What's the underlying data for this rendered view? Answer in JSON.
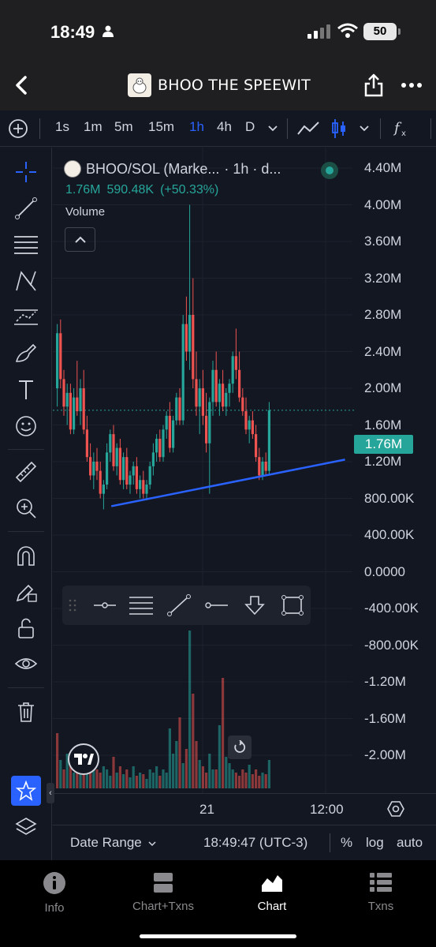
{
  "status_bar": {
    "time": "18:49",
    "battery": "50"
  },
  "header": {
    "title": "BHOO THE SPEEWIT"
  },
  "toolbar": {
    "intervals": [
      "1s",
      "1m",
      "5m",
      "15m",
      "1h",
      "4h",
      "D"
    ],
    "active_interval": "1h"
  },
  "legend": {
    "symbol": "BHOO/SOL (Marke...",
    "interval_text": "· 1h · d...",
    "price": "1.76M",
    "change_abs": "590.48K",
    "change_pct": "(+50.33%)",
    "volume_label": "Volume"
  },
  "price_axis": [
    "4.40M",
    "4.00M",
    "3.60M",
    "3.20M",
    "2.80M",
    "2.40M",
    "2.00M",
    "1.60M",
    "1.20M",
    "800.00K",
    "400.00K",
    "0.0000",
    "-400.00K",
    "-800.00K",
    "-1.20M",
    "-1.60M",
    "-2.00M"
  ],
  "last_price_tag": "1.76M",
  "time_axis": {
    "day_label": "21",
    "time_label": "12:00"
  },
  "bottom_controls": {
    "date_range": "Date Range",
    "clock": "18:49:47 (UTC-3)",
    "percent": "%",
    "log": "log",
    "auto": "auto"
  },
  "nav": {
    "items": [
      {
        "label": "Info",
        "icon": "info-icon"
      },
      {
        "label": "Chart+Txns",
        "icon": "split-view-icon"
      },
      {
        "label": "Chart",
        "icon": "chart-icon"
      },
      {
        "label": "Txns",
        "icon": "list-icon"
      }
    ],
    "active": "Chart"
  },
  "colors": {
    "up": "#26a69a",
    "down": "#ef5350",
    "accent": "#2962ff",
    "trendline": "#2962ff"
  },
  "chart_data": {
    "type": "candlestick",
    "ylim": [
      -2200000,
      4600000
    ],
    "trendline": {
      "from": [
        1,
        680000
      ],
      "to": [
        73,
        1240000
      ]
    },
    "candles": [
      [
        2000000.0,
        2700000.0,
        1800000.0,
        2600000.0
      ],
      [
        2600000.0,
        2750000.0,
        2000000.0,
        2100000.0
      ],
      [
        2100000.0,
        2200000.0,
        1700000.0,
        1800000.0
      ],
      [
        1800000.0,
        2050000.0,
        1600000.0,
        1950000.0
      ],
      [
        1950000.0,
        2050000.0,
        1500000.0,
        1550000.0
      ],
      [
        1550000.0,
        2000000.0,
        1500000.0,
        1900000.0
      ],
      [
        1900000.0,
        2300000.0,
        1700000.0,
        1750000.0
      ],
      [
        1750000.0,
        2100000.0,
        1600000.0,
        2000000.0
      ],
      [
        2000000.0,
        2200000.0,
        1500000.0,
        1550000.0
      ],
      [
        1550000.0,
        1700000.0,
        1200000.0,
        1250000.0
      ],
      [
        1250000.0,
        1400000.0,
        1000000.0,
        1050000.0
      ],
      [
        1050000.0,
        1300000.0,
        900000.0,
        1200000.0
      ],
      [
        1200000.0,
        1350000.0,
        1000000.0,
        1100000.0
      ],
      [
        1100000.0,
        1200000.0,
        800000.0,
        850000.0
      ],
      [
        850000.0,
        1000000.0,
        680000.0,
        950000.0
      ],
      [
        950000.0,
        1400000.0,
        900000.0,
        1300000.0
      ],
      [
        1300000.0,
        1550000.0,
        1200000.0,
        1500000.0
      ],
      [
        1500000.0,
        1600000.0,
        1100000.0,
        1150000.0
      ],
      [
        1150000.0,
        1400000.0,
        1050000.0,
        1350000.0
      ],
      [
        1350000.0,
        1450000.0,
        950000.0,
        1000000.0
      ],
      [
        1000000.0,
        1300000.0,
        900000.0,
        1250000.0
      ],
      [
        1250000.0,
        1350000.0,
        900000.0,
        950000.0
      ],
      [
        950000.0,
        1100000.0,
        850000.0,
        1050000.0
      ],
      [
        1050000.0,
        1200000.0,
        950000.0,
        1150000.0
      ],
      [
        1150000.0,
        1250000.0,
        850000.0,
        900000.0
      ],
      [
        900000.0,
        1050000.0,
        800000.0,
        1000000.0
      ],
      [
        1000000.0,
        1100000.0,
        800000.0,
        850000.0
      ],
      [
        850000.0,
        1000000.0,
        780000.0,
        950000.0
      ],
      [
        950000.0,
        1200000.0,
        900000.0,
        1150000.0
      ],
      [
        1150000.0,
        1400000.0,
        1050000.0,
        1300000.0
      ],
      [
        1300000.0,
        1500000.0,
        1200000.0,
        1450000.0
      ],
      [
        1450000.0,
        1550000.0,
        1200000.0,
        1250000.0
      ],
      [
        1250000.0,
        1600000.0,
        1200000.0,
        1550000.0
      ],
      [
        1550000.0,
        1750000.0,
        1450000.0,
        1700000.0
      ],
      [
        1700000.0,
        1850000.0,
        1300000.0,
        1350000.0
      ],
      [
        1350000.0,
        1700000.0,
        1300000.0,
        1650000.0
      ],
      [
        1650000.0,
        1950000.0,
        1600000.0,
        1900000.0
      ],
      [
        1900000.0,
        2000000.0,
        1600000.0,
        1650000.0
      ],
      [
        1650000.0,
        2800000.0,
        1600000.0,
        2700000.0
      ],
      [
        2700000.0,
        3000000.0,
        2300000.0,
        2400000.0
      ],
      [
        2400000.0,
        4000000.0,
        2200000.0,
        2800000.0
      ],
      [
        2800000.0,
        3200000.0,
        2000000.0,
        2100000.0
      ],
      [
        2100000.0,
        2400000.0,
        1700000.0,
        1800000.0
      ],
      [
        1800000.0,
        2100000.0,
        1500000.0,
        2000000.0
      ],
      [
        2000000.0,
        2200000.0,
        1600000.0,
        1700000.0
      ],
      [
        1700000.0,
        1950000.0,
        1300000.0,
        1400000.0
      ],
      [
        1400000.0,
        1900000.0,
        850000.0,
        1850000.0
      ],
      [
        1850000.0,
        2300000.0,
        1700000.0,
        2200000.0
      ],
      [
        2200000.0,
        2400000.0,
        1800000.0,
        1850000.0
      ],
      [
        1850000.0,
        2100000.0,
        1700000.0,
        2050000.0
      ],
      [
        2050000.0,
        2200000.0,
        1750000.0,
        1800000.0
      ],
      [
        1800000.0,
        2000000.0,
        1700000.0,
        1950000.0
      ],
      [
        1950000.0,
        2100000.0,
        1800000.0,
        2050000.0
      ],
      [
        2050000.0,
        2400000.0,
        1950000.0,
        2350000.0
      ],
      [
        2350000.0,
        2650000.0,
        2100000.0,
        2200000.0
      ],
      [
        2200000.0,
        2400000.0,
        1850000.0,
        1900000.0
      ],
      [
        1900000.0,
        2000000.0,
        1700000.0,
        1750000.0
      ],
      [
        1750000.0,
        1900000.0,
        1500000.0,
        1550000.0
      ],
      [
        1550000.0,
        1700000.0,
        1400000.0,
        1650000.0
      ],
      [
        1650000.0,
        1750000.0,
        1450000.0,
        1500000.0
      ],
      [
        1500000.0,
        1600000.0,
        1200000.0,
        1250000.0
      ],
      [
        1250000.0,
        1350000.0,
        1000000.0,
        1050000.0
      ],
      [
        1050000.0,
        1250000.0,
        1000000.0,
        1200000.0
      ],
      [
        1200000.0,
        1300000.0,
        1050000.0,
        1100000.0
      ],
      [
        1100000.0,
        1850000.0,
        1050000.0,
        1760000.0
      ]
    ],
    "volumes": [
      0.35,
      0.18,
      0.12,
      0.22,
      0.15,
      0.1,
      0.14,
      0.19,
      0.12,
      0.15,
      0.1,
      0.24,
      0.12,
      0.1,
      0.14,
      0.12,
      0.08,
      0.2,
      0.1,
      0.14,
      0.09,
      0.12,
      0.07,
      0.14,
      0.08,
      0.1,
      0.09,
      0.06,
      0.12,
      0.1,
      0.14,
      0.08,
      0.12,
      0.1,
      0.38,
      0.22,
      0.3,
      0.45,
      0.16,
      0.25,
      1.0,
      0.6,
      0.3,
      0.18,
      0.14,
      0.1,
      0.22,
      0.12,
      0.12,
      0.4,
      0.7,
      0.2,
      0.16,
      0.12,
      0.1,
      0.08,
      0.12,
      0.1,
      0.15,
      0.09,
      0.12,
      0.08,
      0.1,
      0.09,
      0.18
    ],
    "volume_up": [
      0,
      1,
      0,
      1,
      0,
      1,
      0,
      1,
      0,
      1,
      0,
      1,
      0,
      0,
      1,
      1,
      1,
      0,
      1,
      0,
      1,
      0,
      1,
      1,
      0,
      1,
      0,
      1,
      1,
      1,
      1,
      0,
      1,
      1,
      1,
      1,
      1,
      0,
      1,
      0,
      1,
      0,
      0,
      1,
      0,
      0,
      1,
      1,
      0,
      1,
      0,
      1,
      1,
      1,
      0,
      0,
      0,
      0,
      1,
      0,
      0,
      0,
      1,
      0,
      1
    ]
  }
}
